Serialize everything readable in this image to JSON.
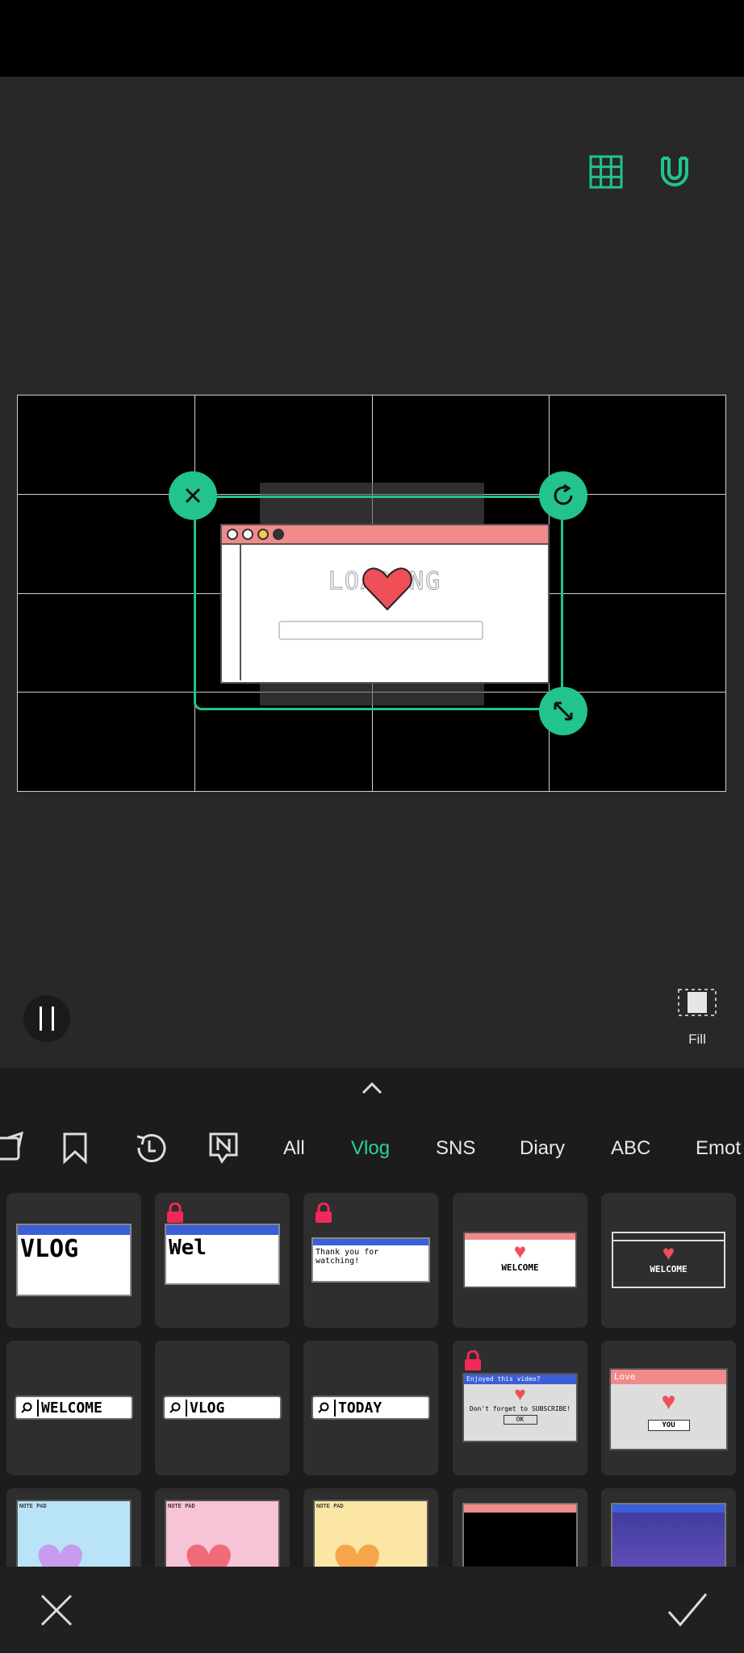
{
  "toolbar": {
    "grid_icon": "grid-icon",
    "snap_icon": "magnet-icon",
    "accent_color": "#22c38e"
  },
  "sticker": {
    "title_text": "LOADING"
  },
  "playback": {
    "fill_label": "Fill"
  },
  "categories": {
    "icons": [
      "sticker-icon",
      "bookmark-icon",
      "recent-icon",
      "new-icon"
    ],
    "tabs": [
      "All",
      "Vlog",
      "SNS",
      "Diary",
      "ABC",
      "Emot"
    ],
    "active_tab": "Vlog"
  },
  "tiles": {
    "row1": [
      {
        "text": "VLOG",
        "locked": false
      },
      {
        "text": "Wel",
        "locked": true
      },
      {
        "text": "Thank you for watching!",
        "locked": true
      },
      {
        "text": "WELCOME",
        "locked": false
      },
      {
        "text": "WELCOME",
        "locked": false
      }
    ],
    "row2": [
      {
        "text": "WELCOME",
        "locked": false
      },
      {
        "text": "VLOG",
        "locked": false
      },
      {
        "text": "TODAY",
        "locked": false
      },
      {
        "title": "Enjoyed this video?",
        "text": "Don't forget to SUBSCRIBE!",
        "button": "OK",
        "locked": true
      },
      {
        "title": "Love",
        "button": "YOU",
        "locked": false
      }
    ],
    "row3": [
      {
        "text": "NOTE PAD",
        "locked": false
      },
      {
        "text": "NOTE PAD",
        "locked": false
      },
      {
        "text": "NOTE PAD",
        "locked": false
      },
      {
        "text": "",
        "locked": false
      },
      {
        "text": "",
        "locked": false
      }
    ]
  },
  "bottom": {
    "cancel_icon": "close-icon",
    "confirm_icon": "check-icon"
  }
}
